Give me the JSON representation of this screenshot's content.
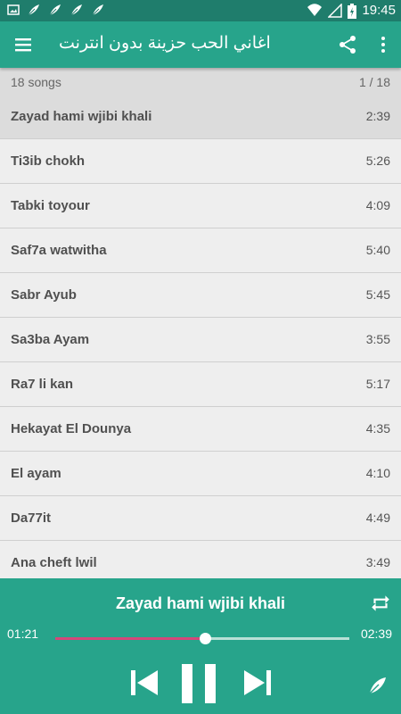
{
  "status_bar": {
    "time": "19:45",
    "left_icons": [
      "image-icon",
      "leaf-icon",
      "leaf-icon",
      "leaf-icon",
      "leaf-icon"
    ],
    "right_icons": [
      "wifi-icon",
      "signal-icon",
      "battery-charging-icon"
    ]
  },
  "app_bar": {
    "title": "اغاني الحب حزينة بدون انترنت",
    "icons": [
      "menu-icon",
      "share-icon",
      "more-vert-icon"
    ],
    "color": "#27a48b"
  },
  "list": {
    "count_label": "18 songs",
    "page_label": "1 / 18",
    "active_index": 0,
    "songs": [
      {
        "title": "Zayad hami wjibi khali",
        "duration": "2:39"
      },
      {
        "title": "Ti3ib chokh",
        "duration": "5:26"
      },
      {
        "title": "Tabki toyour",
        "duration": "4:09"
      },
      {
        "title": "Saf7a watwitha",
        "duration": "5:40"
      },
      {
        "title": "Sabr Ayub",
        "duration": "5:45"
      },
      {
        "title": "Sa3ba Ayam",
        "duration": "3:55"
      },
      {
        "title": "Ra7 li kan",
        "duration": "5:17"
      },
      {
        "title": "Hekayat El Dounya",
        "duration": "4:35"
      },
      {
        "title": "El ayam",
        "duration": "4:10"
      },
      {
        "title": "Da77it",
        "duration": "4:49"
      },
      {
        "title": "Ana cheft lwil",
        "duration": "3:49"
      }
    ]
  },
  "player": {
    "now_playing": "Zayad hami wjibi khali",
    "current_time": "01:21",
    "total_time": "02:39",
    "progress": 0.51,
    "accent_color": "#d4477a",
    "icons": [
      "repeat-icon",
      "skip-previous-icon",
      "pause-icon",
      "skip-next-icon",
      "leaf-icon"
    ]
  }
}
